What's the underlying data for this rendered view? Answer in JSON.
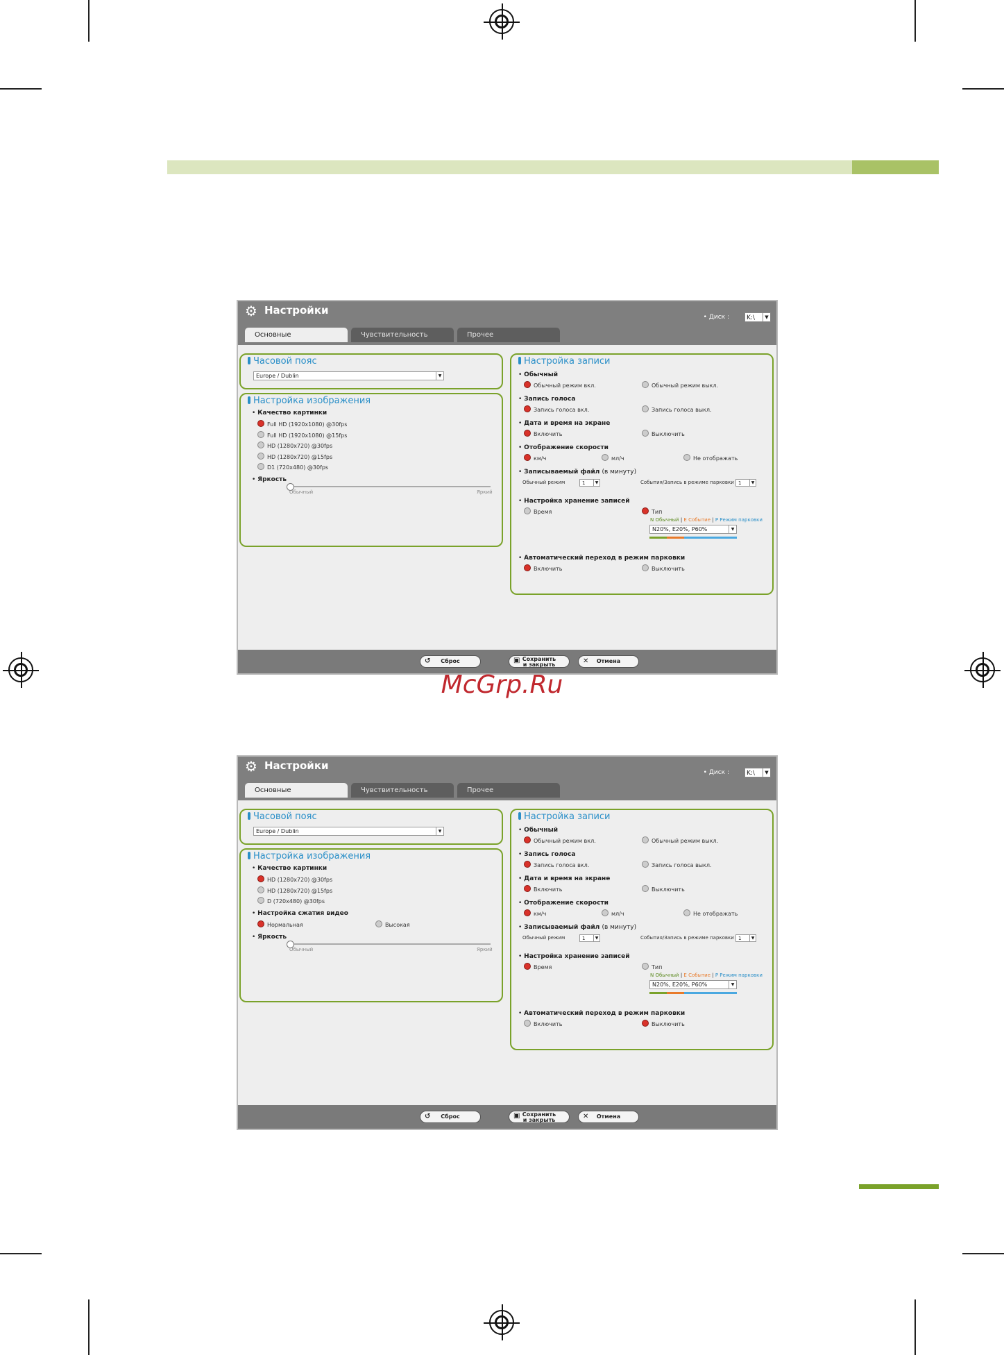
{
  "watermark": "McGrp.Ru",
  "screens": [
    {
      "title": "Настройки",
      "disk_label": "• Диск :",
      "disk_value": "K:\\",
      "tabs": [
        "Основные",
        "Чувствительность",
        "Прочее"
      ],
      "timezone": {
        "title": "Часовой пояс",
        "value": "Europe / Dublin"
      },
      "image": {
        "title": "Настройка изображения",
        "quality_label": "Качество картинки",
        "quality_options": [
          {
            "label": "Full HD (1920x1080) @30fps",
            "selected": true
          },
          {
            "label": "Full HD (1920x1080) @15fps",
            "selected": false
          },
          {
            "label": "HD (1280x720) @30fps",
            "selected": false
          },
          {
            "label": "HD (1280x720) @15fps",
            "selected": false
          },
          {
            "label": "D1 (720x480) @30fps",
            "selected": false
          }
        ],
        "brightness_label": "Яркость",
        "brightness_min": "Обычный",
        "brightness_max": "Яркий"
      },
      "record": {
        "title": "Настройка записи",
        "normal_label": "Обычный",
        "normal_on": "Обычный режим вкл.",
        "normal_off": "Обычный режим выкл.",
        "voice_label": "Запись голоса",
        "voice_on": "Запись голоса вкл.",
        "voice_off": "Запись голоса выкл.",
        "datetime_label": "Дата и время на экране",
        "datetime_on": "Включить",
        "datetime_off": "Выключить",
        "speed_label": "Отображение скорости",
        "speed_kmh": "км/ч",
        "speed_mph": "мл/ч",
        "speed_none": "Не отображать",
        "file_label": "Записываемый файл",
        "file_unit": "(в минуту)",
        "file_normal": "Обычный режим",
        "file_normal_value": "1",
        "file_event": "События/Запись в режиме парковки",
        "file_event_value": "1",
        "storage_label": "Настройка хранение записей",
        "storage_time": "Время",
        "storage_type": "Тип",
        "legend_n": "N Обычный",
        "legend_e": "E Событие",
        "legend_p": "P Режим парковки",
        "ratio_value": "N20%, E20%, P60%",
        "auto_park_label": "Автоматический переход в режим парковки",
        "auto_park_on": "Включить",
        "auto_park_off": "Выключить"
      },
      "buttons": {
        "reset": "Сброс",
        "save": "Сохранить и закрыть",
        "cancel": "Отмена"
      }
    },
    {
      "title": "Настройки",
      "disk_label": "• Диск :",
      "disk_value": "K:\\",
      "tabs": [
        "Основные",
        "Чувствительность",
        "Прочее"
      ],
      "timezone": {
        "title": "Часовой пояс",
        "value": "Europe / Dublin"
      },
      "image": {
        "title": "Настройка изображения",
        "quality_label": "Качество картинки",
        "quality_options": [
          {
            "label": "HD (1280x720) @30fps",
            "selected": true
          },
          {
            "label": "HD (1280x720) @15fps",
            "selected": false
          },
          {
            "label": "D (720x480) @30fps",
            "selected": false
          }
        ],
        "compression_label": "Настройка сжатия видео",
        "compression_normal": "Нормальная",
        "compression_high": "Высокая",
        "brightness_label": "Яркость",
        "brightness_min": "Обычный",
        "brightness_max": "Яркий"
      },
      "record": {
        "title": "Настройка записи",
        "normal_label": "Обычный",
        "normal_on": "Обычный режим вкл.",
        "normal_off": "Обычный режим выкл.",
        "voice_label": "Запись голоса",
        "voice_on": "Запись голоса вкл.",
        "voice_off": "Запись голоса выкл.",
        "datetime_label": "Дата и время на экране",
        "datetime_on": "Включить",
        "datetime_off": "Выключить",
        "speed_label": "Отображение скорости",
        "speed_kmh": "км/ч",
        "speed_mph": "мл/ч",
        "speed_none": "Не отображать",
        "file_label": "Записываемый файл",
        "file_unit": "(в минуту)",
        "file_normal": "Обычный режим",
        "file_normal_value": "1",
        "file_event": "События/Запись в режиме парковки",
        "file_event_value": "1",
        "storage_label": "Настройка хранение записей",
        "storage_time": "Время",
        "storage_type": "Тип",
        "legend_n": "N Обычный",
        "legend_e": "E Событие",
        "legend_p": "P Режим парковки",
        "ratio_value": "N20%, E20%, P60%",
        "auto_park_label": "Автоматический переход в режим парковки",
        "auto_park_on": "Включить",
        "auto_park_off": "Выключить"
      },
      "buttons": {
        "reset": "Сброс",
        "save": "Сохранить и закрыть",
        "cancel": "Отмена"
      }
    }
  ]
}
